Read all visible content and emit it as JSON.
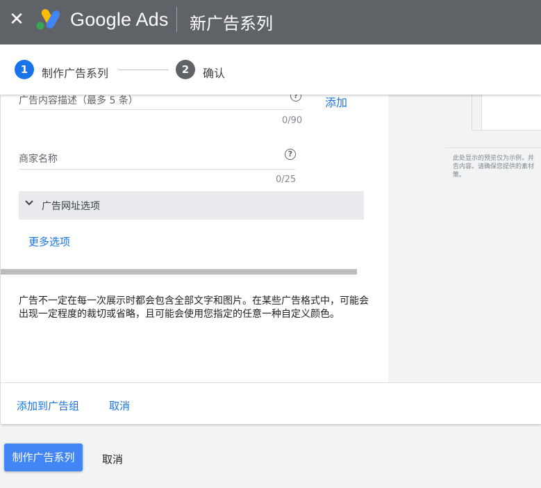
{
  "header": {
    "close_icon": "close-icon",
    "brand": "Google Ads",
    "title": "新广告系列"
  },
  "stepper": {
    "steps": [
      {
        "number": "1",
        "label": "制作广告系列",
        "status": "active"
      },
      {
        "number": "2",
        "label": "确认",
        "status": "inactive"
      }
    ]
  },
  "form": {
    "description": {
      "label": "广告内容描述（最多 5 条）",
      "counter": "0/90",
      "add_link": "添加"
    },
    "business_name": {
      "label": "商家名称",
      "counter": "0/25"
    },
    "url_options": {
      "label": "广告网址选项"
    },
    "more_options": "更多选项",
    "disclaimer": "广告不一定在每一次展示时都会包含全部文字和图片。在某些广告格式中，可能会出现一定程度的裁切或省略，且可能会使用您指定的任意一种自定义颜色。"
  },
  "preview": {
    "note_lines": [
      "此处显示的预览仅为示例，并",
      "告内容。请确保您提供的素材",
      "策。"
    ]
  },
  "card_footer": {
    "add_to_group": "添加到广告组",
    "cancel": "取消"
  },
  "page_footer": {
    "create": "制作广告系列",
    "cancel": "取消"
  },
  "colors": {
    "header_bg": "#5f6368",
    "accent": "#1a73e8",
    "primary_button": "#4285f4"
  }
}
